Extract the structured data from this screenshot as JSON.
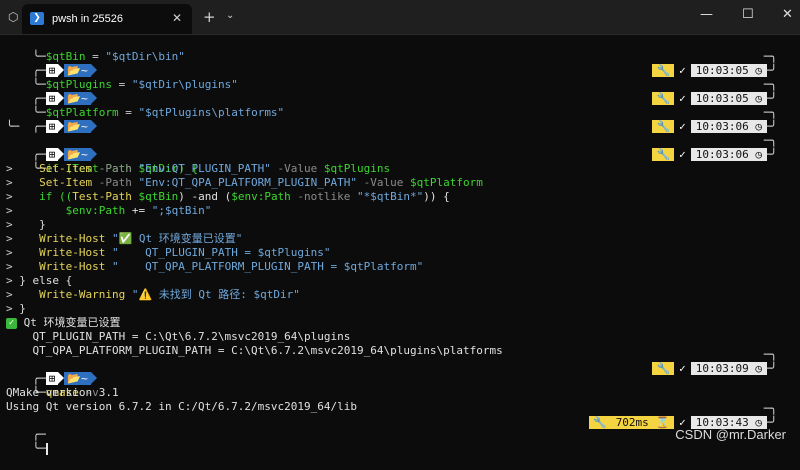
{
  "titlebar": {
    "tab_title": "pwsh in 25526",
    "tab_close": "✕",
    "new_tab": "+",
    "dropdown": "⌄",
    "minimize": "—",
    "maximize": "☐",
    "close": "✕"
  },
  "prompt": {
    "os_icon": "⊞",
    "path_icon": "📂",
    "path": "~",
    "frame_top": "╭─",
    "frame_bottom": "╰─"
  },
  "lines": {
    "l1_var": "$qtBin",
    "l1_op": " = ",
    "l1_str": "\"$qtDir\\bin\"",
    "l2_var": "$qtPlugins",
    "l2_op": " = ",
    "l2_str": "\"$qtDir\\plugins\"",
    "l3_var": "$qtPlatform",
    "l3_op": " = ",
    "l3_str": "\"$qtPlugins\\platforms\"",
    "if_line": "if (Test-Path $qtDir) {",
    "set1_cmd": "Set-Item",
    "set1_p1": " -Path ",
    "set1_s1": "\"Env:QT_PLUGIN_PATH\"",
    "set1_p2": " -Value ",
    "set1_v": "$qtPlugins",
    "set2_cmd": "Set-Item",
    "set2_p1": " -Path ",
    "set2_s1": "\"Env:QT_QPA_PLATFORM_PLUGIN_PATH\"",
    "set2_p2": " -Value ",
    "set2_v": "$qtPlatform",
    "if2_a": "if ((",
    "if2_cmd": "Test-Path",
    "if2_v1": " $qtBin",
    "if2_b": ") -and (",
    "if2_v2": "$env:Path",
    "if2_c": " -notlike ",
    "if2_s": "\"*$qtBin*\"",
    "if2_d": ")) {",
    "env_v": "$env:Path",
    "env_op": " += ",
    "env_s": "\";$qtBin\"",
    "close1": "}",
    "wh1_cmd": "Write-Host",
    "wh1_s": " \"✅ Qt 环境变量已设置\"",
    "wh2_cmd": "Write-Host",
    "wh2_s": " \"    QT_PLUGIN_PATH = $qtPlugins\"",
    "wh3_cmd": "Write-Host",
    "wh3_s": " \"    QT_QPA_PLATFORM_PLUGIN_PATH = $qtPlatform\"",
    "else_line": "} else {",
    "ww_cmd": "Write-Warning",
    "ww_s": " \"⚠️ 未找到 Qt 路径: $qtDir\"",
    "close2": "}",
    "out1": " Qt 环境变量已设置",
    "out2": "    QT_PLUGIN_PATH = C:\\Qt\\6.7.2\\msvc2019_64\\plugins",
    "out3": "    QT_QPA_PLATFORM_PLUGIN_PATH = C:\\Qt\\6.7.2\\msvc2019_64\\plugins\\platforms",
    "qmake_cmd": "qmake",
    "qmake_arg": " -v",
    "qm_out1": "QMake version 3.1",
    "qm_out2": "Using Qt version 6.7.2 in C:/Qt/6.7.2/msvc2019_64/lib",
    "cont": ">"
  },
  "rprompts": {
    "tool_icon": "🔧",
    "ok": "✓",
    "clock": "◷",
    "hourglass": "⌛",
    "t1": "10:03:05",
    "t2": "10:03:05",
    "t3": "10:03:06",
    "t4": "10:03:06",
    "t5": "10:03:09",
    "t6": "10:03:43",
    "duration": "702ms"
  },
  "watermark": "CSDN @mr.Darker"
}
